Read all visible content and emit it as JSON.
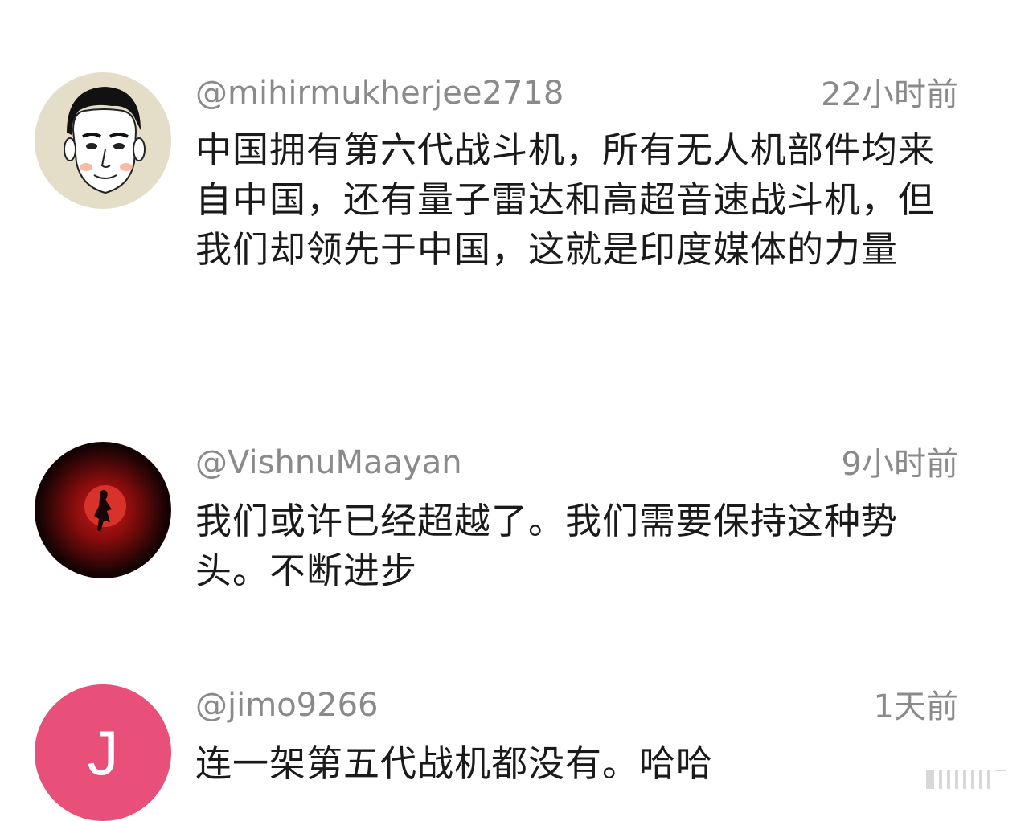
{
  "comments": [
    {
      "username": "@mihirmukherjee2718",
      "time": "22小时前",
      "text": "中国拥有第六代战斗机，所有无人机部件均来自中国，还有量子雷达和高超音速战斗机，但我们却领先于中国，这就是印度媒体的力量",
      "avatar": {
        "kind": "illustration",
        "description_icon": "cartoon-face-avatar",
        "bg": "#e4ddc8"
      }
    },
    {
      "username": "@VishnuMaayan",
      "time": "9小时前",
      "text": "我们或许已经超越了。我们需要保持这种势头。不断进步",
      "avatar": {
        "kind": "illustration",
        "description_icon": "red-moon-figure-avatar",
        "bg": "#1a0506"
      }
    },
    {
      "username": "@jimo9266",
      "time": "1天前",
      "text": "连一架第五代战机都没有。哈哈",
      "avatar": {
        "kind": "letter",
        "letter": "J",
        "bg": "#e8507a"
      }
    }
  ]
}
